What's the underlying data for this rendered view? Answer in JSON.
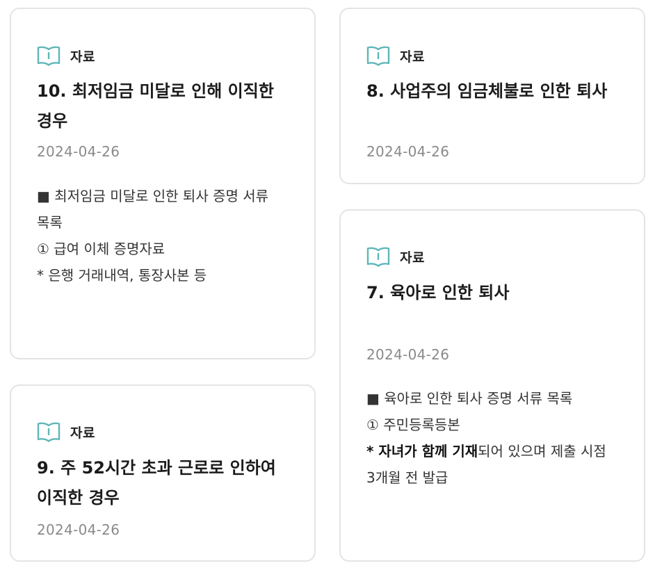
{
  "colors": {
    "accent": "#5fb6b8",
    "border": "#e4e4e4",
    "date": "#8a8a8a"
  },
  "cards": [
    {
      "tag_icon": "book-open-icon",
      "tag": "자료",
      "title": "10. 최저임금 미달로 인해 이직한 경우",
      "date": "2024-04-26",
      "body": [
        "■ 최저임금 미달로 인한 퇴사 증명 서류 목록",
        "① 급여 이체 증명자료",
        "* 은행 거래내역, 통장사본 등"
      ]
    },
    {
      "tag_icon": "book-open-icon",
      "tag": "자료",
      "title": "8. 사업주의 임금체불로 인한 퇴사",
      "date": "2024-04-26"
    },
    {
      "tag_icon": "book-open-icon",
      "tag": "자료",
      "title": "9. 주 52시간 초과 근로로 인하여 이직한 경우",
      "date": "2024-04-26"
    },
    {
      "tag_icon": "book-open-icon",
      "tag": "자료",
      "title": "7. 육아로 인한 퇴사",
      "date": "2024-04-26",
      "body": [
        "■ 육아로 인한 퇴사 증명 서류 목록",
        "① 주민등록등본"
      ],
      "body_note_bold": "* 자녀가 함께 기재",
      "body_note_rest": "되어 있으며 제출 시점 3개월 전 발급"
    }
  ]
}
